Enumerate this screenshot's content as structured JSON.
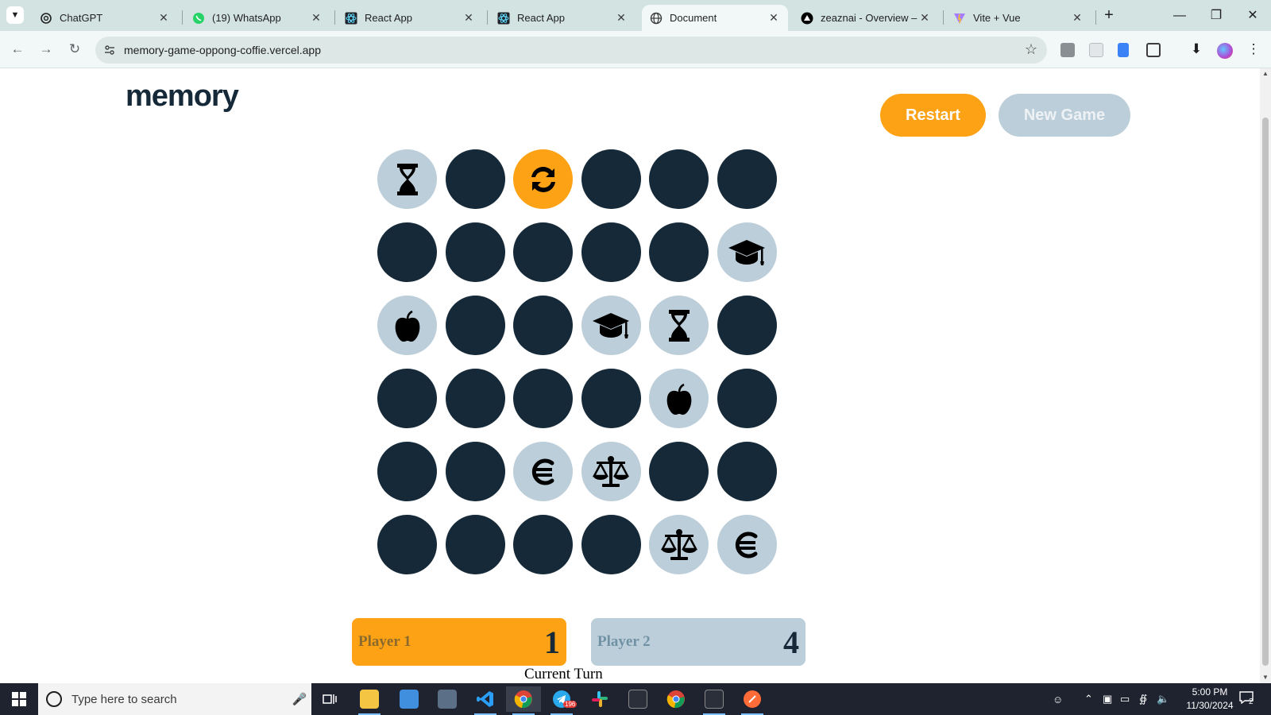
{
  "browser": {
    "tabs": [
      {
        "title": "ChatGPT",
        "icon": "chatgpt-icon",
        "active": false
      },
      {
        "title": "(19) WhatsApp",
        "icon": "whatsapp-icon",
        "active": false
      },
      {
        "title": "React App",
        "icon": "react-icon",
        "active": false
      },
      {
        "title": "React App",
        "icon": "react-icon",
        "active": false
      },
      {
        "title": "Document",
        "icon": "globe-icon",
        "active": true
      },
      {
        "title": "zeaznai - Overview – V",
        "icon": "vercel-icon",
        "active": false
      },
      {
        "title": "Vite + Vue",
        "icon": "vite-icon",
        "active": false
      }
    ],
    "url": "memory-game-oppong-coffie.vercel.app"
  },
  "game": {
    "logo": "memory",
    "restart_label": "Restart",
    "new_game_label": "New Game",
    "grid": [
      [
        {
          "state": "matched",
          "icon": "hourglass-icon"
        },
        {
          "state": "hidden"
        },
        {
          "state": "selected",
          "icon": "rotate-icon"
        },
        {
          "state": "hidden"
        },
        {
          "state": "hidden"
        },
        {
          "state": "hidden"
        }
      ],
      [
        {
          "state": "hidden"
        },
        {
          "state": "hidden"
        },
        {
          "state": "hidden"
        },
        {
          "state": "hidden"
        },
        {
          "state": "hidden"
        },
        {
          "state": "matched",
          "icon": "graduation-cap-icon"
        }
      ],
      [
        {
          "state": "matched",
          "icon": "apple-icon"
        },
        {
          "state": "hidden"
        },
        {
          "state": "hidden"
        },
        {
          "state": "matched",
          "icon": "graduation-cap-icon"
        },
        {
          "state": "matched",
          "icon": "hourglass-icon"
        },
        {
          "state": "hidden"
        }
      ],
      [
        {
          "state": "hidden"
        },
        {
          "state": "hidden"
        },
        {
          "state": "hidden"
        },
        {
          "state": "hidden"
        },
        {
          "state": "matched",
          "icon": "apple-icon"
        },
        {
          "state": "hidden"
        }
      ],
      [
        {
          "state": "hidden"
        },
        {
          "state": "hidden"
        },
        {
          "state": "matched",
          "icon": "cedi-sign-icon"
        },
        {
          "state": "matched",
          "icon": "scale-balanced-icon"
        },
        {
          "state": "hidden"
        },
        {
          "state": "hidden"
        }
      ],
      [
        {
          "state": "hidden"
        },
        {
          "state": "hidden"
        },
        {
          "state": "hidden"
        },
        {
          "state": "hidden"
        },
        {
          "state": "matched",
          "icon": "scale-balanced-icon"
        },
        {
          "state": "matched",
          "icon": "cedi-sign-icon"
        }
      ]
    ],
    "players": [
      {
        "name": "Player 1",
        "score": "1",
        "active": true
      },
      {
        "name": "Player 2",
        "score": "4",
        "active": false
      }
    ],
    "current_turn_label": "Current Turn"
  },
  "taskbar": {
    "search_placeholder": "Type here to search",
    "time": "5:00 PM",
    "date": "11/30/2024",
    "notification_count": "2",
    "telegram_badge": "196"
  },
  "colors": {
    "dark": "#152938",
    "orange": "#fda214",
    "light_blue": "#bcced9"
  }
}
